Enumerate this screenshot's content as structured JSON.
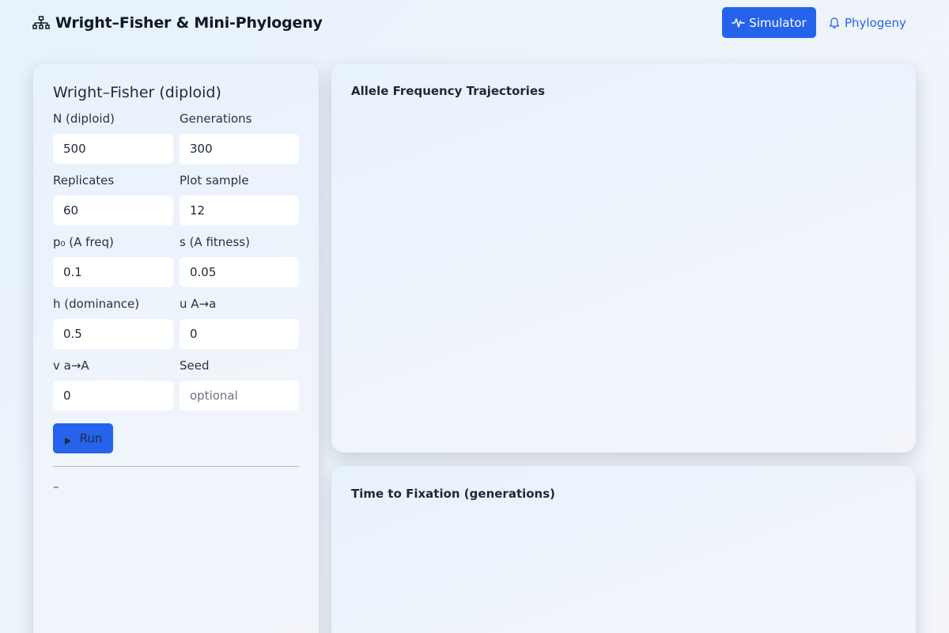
{
  "header": {
    "brand_icon": "network-tree-icon",
    "title": "Wright–Fisher & Mini-Phylogeny",
    "nav": [
      {
        "label": "Simulator",
        "icon": "activity-pulse-icon",
        "active": true
      },
      {
        "label": "Phylogeny",
        "icon": "bell-icon",
        "active": false
      }
    ]
  },
  "colors": {
    "accent": "#2563eb",
    "card_bg": "#eef4fb",
    "input_bg": "#ffffff"
  },
  "sidebar": {
    "title": "Wright–Fisher (diploid)",
    "fields": {
      "n": {
        "label": "N (diploid)",
        "value": "500"
      },
      "generations": {
        "label": "Generations",
        "value": "300"
      },
      "replicates": {
        "label": "Replicates",
        "value": "60"
      },
      "plot_sample": {
        "label": "Plot sample",
        "value": "12"
      },
      "p0": {
        "label": "p₀ (A freq)",
        "value": "0.1"
      },
      "s": {
        "label": "s (A fitness)",
        "value": "0.05"
      },
      "h": {
        "label": "h (dominance)",
        "value": "0.5"
      },
      "u": {
        "label": "u A→a",
        "value": "0"
      },
      "v": {
        "label": "v a→A",
        "value": "0"
      },
      "seed": {
        "label": "Seed",
        "value": "",
        "placeholder": "optional"
      }
    },
    "run_button": {
      "label": "Run",
      "icon": "play-icon"
    },
    "result_text": "–"
  },
  "charts": {
    "trajectories": {
      "title": "Allele Frequency Trajectories"
    },
    "fixation": {
      "title": "Time to Fixation (generations)"
    }
  }
}
